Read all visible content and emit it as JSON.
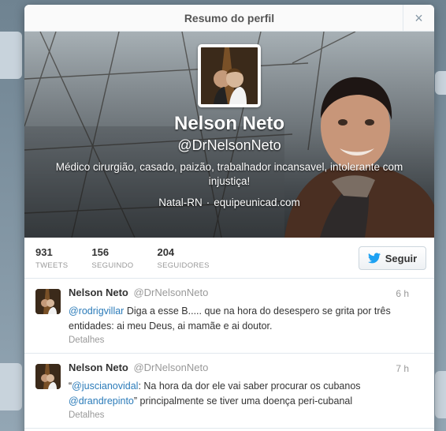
{
  "modal": {
    "title": "Resumo do perfil",
    "close_glyph": "×"
  },
  "profile": {
    "name": "Nelson Neto",
    "handle": "@DrNelsonNeto",
    "bio": "Médico cirurgião, casado, paizão, trabalhador incansavel, intolerante com injustiça!",
    "location": "Natal-RN",
    "separator": "·",
    "website": "equipeunicad.com"
  },
  "stats": [
    {
      "value": "931",
      "label": "TWEETS"
    },
    {
      "value": "156",
      "label": "SEGUINDO"
    },
    {
      "value": "204",
      "label": "SEGUIDORES"
    }
  ],
  "follow_button": {
    "label": "Seguir",
    "icon": "twitter-bird-icon",
    "color": "#1da1f2"
  },
  "tweets": [
    {
      "name": "Nelson Neto",
      "handle": "@DrNelsonNeto",
      "time": "6 h",
      "pre": "",
      "mention1": "@rodrigvillar",
      "mid": " Diga a esse B..... que na hora do desespero se grita por três entidades: ai meu Deus, ai mamãe e ai doutor.",
      "mention2": "",
      "post": "",
      "details": "Detalhes"
    },
    {
      "name": "Nelson Neto",
      "handle": "@DrNelsonNeto",
      "time": "7 h",
      "pre": "“",
      "mention1": "@juscianovidal",
      "mid": ": Na hora da dor ele vai saber procurar os cubanos ",
      "mention2": "@drandrepinto",
      "post": "” principalmente se tiver uma doença peri-cubanal",
      "details": "Detalhes"
    }
  ],
  "colors": {
    "link": "#2b7bb9",
    "muted": "#999999"
  }
}
